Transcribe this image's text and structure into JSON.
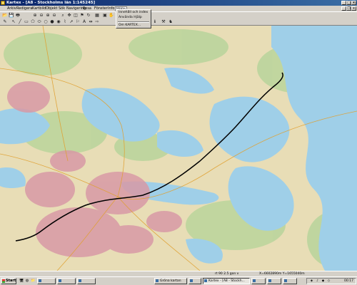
{
  "window": {
    "title": "Kartex - [A8 - Stockholms län 1:145245]",
    "controls": {
      "minimize": "_",
      "maximize": "□",
      "close": "×"
    }
  },
  "menubar": {
    "items": [
      "Arkiv",
      "Redigera",
      "Kartbild",
      "Objekt",
      "Sök",
      "Navigering",
      "Resa",
      "Fönster",
      "Info",
      "Hjälp"
    ],
    "active": "Hjälp"
  },
  "help_menu": {
    "items": [
      "Innehåll och index",
      "Använda Hjälp",
      "Om KARTEX..."
    ]
  },
  "toolbar": {
    "row1_icons": [
      "open-icon",
      "save-icon",
      "print-icon",
      "zoom-in-icon",
      "zoom-out-icon",
      "zoom-in-plus-icon",
      "zoom-out-minus-icon",
      "find-icon",
      "pan-icon",
      "zoom-window-icon",
      "bookmark-icon",
      "refresh-icon",
      "grid-icon",
      "overview-icon",
      "hand-icon"
    ],
    "row2_icons": [
      "pencil-icon",
      "select-icon",
      "line-icon",
      "rectangle-icon",
      "polygon-icon",
      "ellipse-icon",
      "circle-icon",
      "filled-circle-icon",
      "point-icon",
      "route-icon",
      "pointer-icon",
      "flag-icon",
      "text-icon",
      "measure-icon",
      "arrow-icon"
    ],
    "extra_icons": [
      "info-icon",
      "measure-tool-icon",
      "person-icon"
    ]
  },
  "statusbar": {
    "scale": "rt 90 2.5 gon v",
    "coords": "X=6602890m Y=1655040m"
  },
  "taskbar": {
    "start_label": "Start",
    "tasks": [
      {
        "label": "",
        "active": false
      },
      {
        "label": "",
        "active": false
      },
      {
        "label": "",
        "active": false
      },
      {
        "label": "Gröna kartan",
        "active": false
      },
      {
        "label": "",
        "active": false
      },
      {
        "label": "Kartex - [A8 - Stockh...",
        "active": true
      },
      {
        "label": "",
        "active": false
      },
      {
        "label": "",
        "active": false
      },
      {
        "label": "",
        "active": false
      }
    ],
    "clock": "00:17"
  },
  "map": {
    "colors": {
      "land": "#e8ddb6",
      "water": "#9fcfe8",
      "urban": "#d89aa6",
      "forest": "#b6d49a",
      "route": "#000000"
    }
  }
}
